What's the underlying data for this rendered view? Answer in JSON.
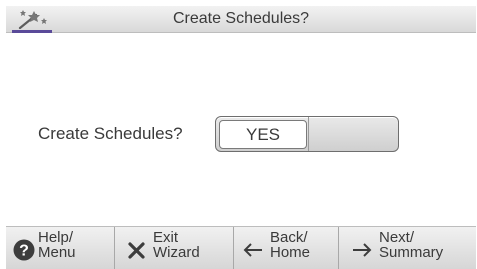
{
  "header": {
    "title": "Create Schedules?",
    "icon": "magic-wand-icon",
    "accent_color": "#5a4a99"
  },
  "main": {
    "prompt": "Create Schedules?",
    "toggle": {
      "selected_label": "YES",
      "other_label": ""
    }
  },
  "footer": {
    "buttons": [
      {
        "icon": "help-icon",
        "line1": "Help/",
        "line2": "Menu"
      },
      {
        "icon": "close-icon",
        "line1": "Exit",
        "line2": "Wizard"
      },
      {
        "icon": "arrow-left-icon",
        "line1": "Back/",
        "line2": "Home"
      },
      {
        "icon": "arrow-right-icon",
        "line1": "Next/",
        "line2": "Summary"
      }
    ]
  }
}
